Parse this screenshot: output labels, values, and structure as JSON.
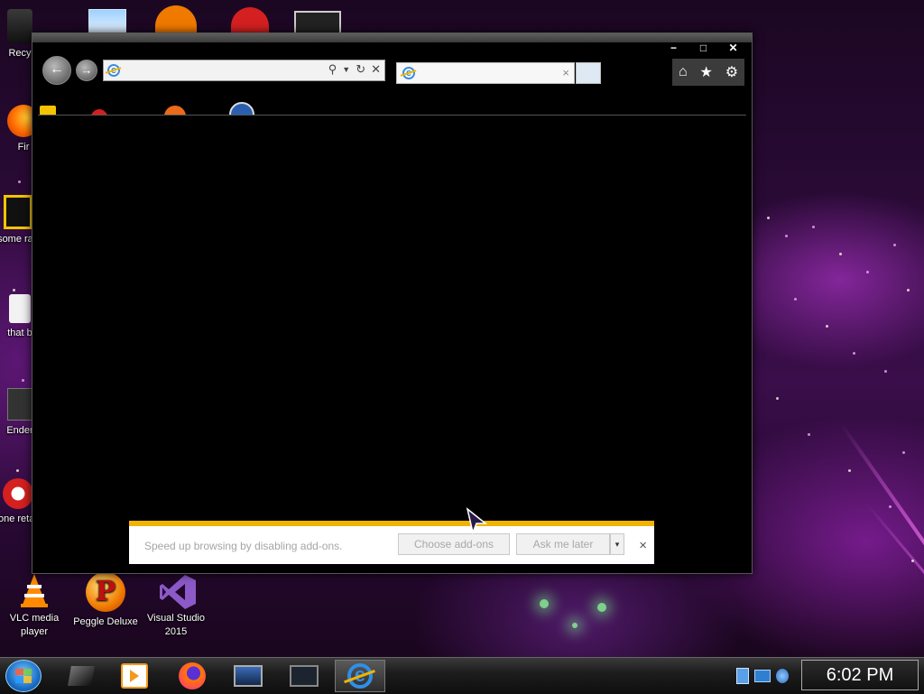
{
  "desktop": {
    "icons": [
      {
        "label": "Recy"
      },
      {
        "label": "Fir"
      },
      {
        "label": "some ran"
      },
      {
        "label": "that b"
      },
      {
        "label": "Ender"
      },
      {
        "label": "none retard"
      },
      {
        "label": "VLC media player"
      },
      {
        "label": "Peggle Deluxe"
      },
      {
        "label": "Visual Studio 2015"
      }
    ]
  },
  "browser": {
    "caption": {
      "minimize": "−",
      "maximize": "□",
      "close": "✕"
    },
    "address": {
      "value": "",
      "placeholder": ""
    },
    "tab": {
      "title": "",
      "close": "×"
    },
    "tools": {
      "home": "⌂",
      "favorites": "★",
      "settings": "⚙"
    }
  },
  "notification": {
    "message": "Speed up browsing by disabling add-ons.",
    "choose_label": "Choose add-ons",
    "ask_label": "Ask me later",
    "dropdown_label": "▾",
    "close_label": "×"
  },
  "taskbar": {
    "clock": "6:02 PM"
  },
  "colors": {
    "notification_accent": "#f0b400",
    "window_frame": "#3b3b3b"
  }
}
